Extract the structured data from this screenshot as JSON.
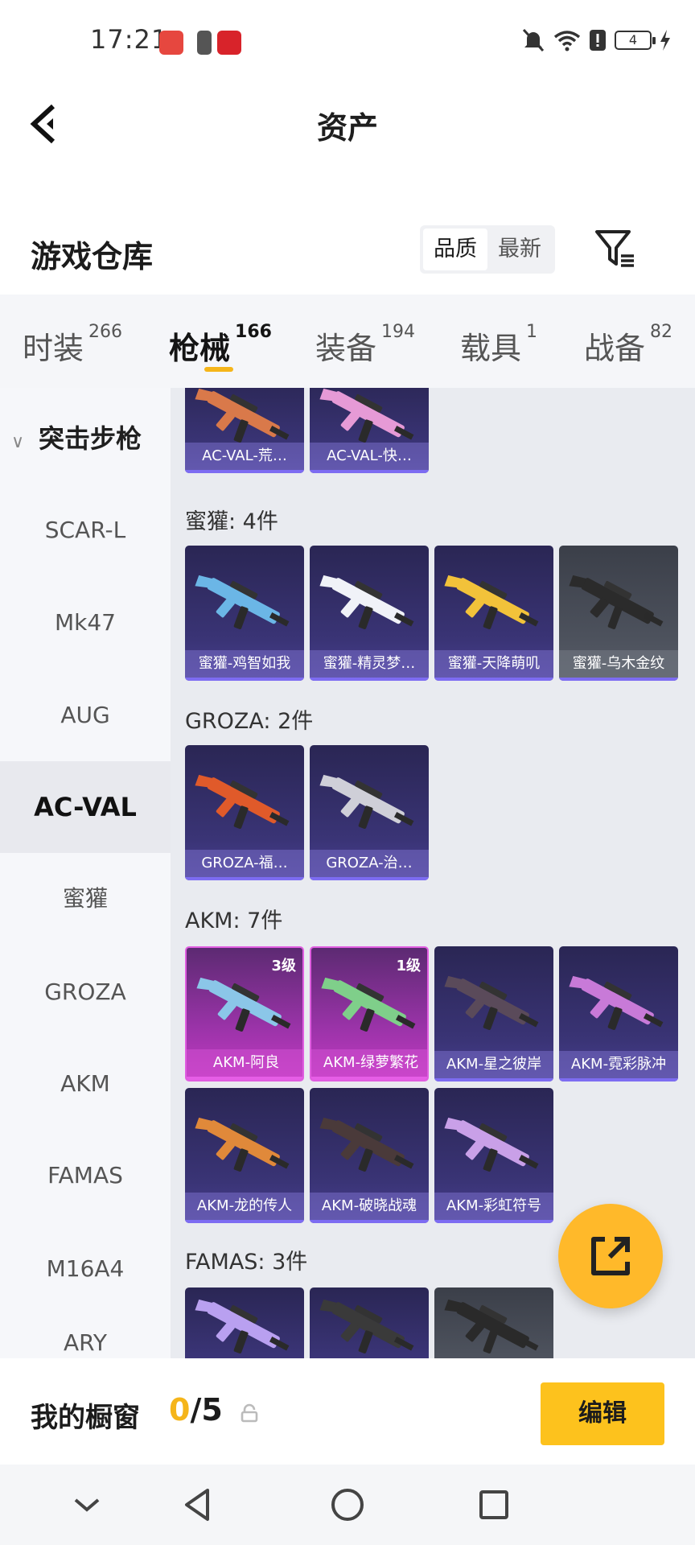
{
  "status_bar": {
    "time": "17:21",
    "battery": "4",
    "icons": [
      "huawei-app-icon",
      "battery-app-icon",
      "heart-app-icon",
      "mute-bell-icon",
      "wifi-icon",
      "alert-icon",
      "battery-icon",
      "charging-icon"
    ]
  },
  "header": {
    "back_icon": "back-chevron-icon",
    "title": "资产"
  },
  "warehouse": {
    "title": "游戏仓库",
    "sort_options": [
      "品质",
      "最新"
    ],
    "sort_selected": "品质",
    "filter_icon": "filter-icon"
  },
  "tabs": [
    {
      "label": "时装",
      "count": "266"
    },
    {
      "label": "枪械",
      "count": "166",
      "active": true
    },
    {
      "label": "装备",
      "count": "194"
    },
    {
      "label": "载具",
      "count": "1"
    },
    {
      "label": "战备",
      "count": "82"
    }
  ],
  "sidebar": {
    "category": "突击步枪",
    "items": [
      "SCAR-L",
      "Mk47",
      "AUG",
      "AC-VAL",
      "蜜獾",
      "GROZA",
      "AKM",
      "FAMAS",
      "M16A4",
      "ARY"
    ],
    "active": "AC-VAL"
  },
  "groups": [
    {
      "label": "",
      "items": [
        {
          "name": "AC-VAL-荒…",
          "style": "purple"
        },
        {
          "name": "AC-VAL-快…",
          "style": "purple"
        }
      ]
    },
    {
      "label": "蜜獾: 4件",
      "items": [
        {
          "name": "蜜獾-鸡智如我",
          "style": "purple"
        },
        {
          "name": "蜜獾-精灵梦…",
          "style": "purple"
        },
        {
          "name": "蜜獾-天降萌叽",
          "style": "purple"
        },
        {
          "name": "蜜獾-乌木金纹",
          "style": "gray"
        }
      ]
    },
    {
      "label": "GROZA: 2件",
      "items": [
        {
          "name": "GROZA-福…",
          "style": "purple"
        },
        {
          "name": "GROZA-治…",
          "style": "purple"
        }
      ]
    },
    {
      "label": "AKM: 7件",
      "items": [
        {
          "name": "AKM-阿良",
          "style": "pink",
          "level": "3级"
        },
        {
          "name": "AKM-绿萝繁花",
          "style": "pink",
          "level": "1级"
        },
        {
          "name": "AKM-星之彼岸",
          "style": "purple"
        },
        {
          "name": "AKM-霓彩脉冲",
          "style": "purple"
        },
        {
          "name": "AKM-龙的传人",
          "style": "purple"
        },
        {
          "name": "AKM-破晓战魂",
          "style": "purple"
        },
        {
          "name": "AKM-彩虹符号",
          "style": "purple"
        }
      ]
    },
    {
      "label": "FAMAS: 3件",
      "items": [
        {
          "name": "",
          "style": "purple"
        },
        {
          "name": "",
          "style": "purple"
        },
        {
          "name": "",
          "style": "gray"
        }
      ]
    }
  ],
  "fab": {
    "icon": "share-external-icon"
  },
  "showcase": {
    "title": "我的橱窗",
    "count_current": "0",
    "count_sep_total": "/5",
    "lock_icon": "lock-icon",
    "edit_label": "编辑"
  },
  "navbar": {
    "icons": [
      "collapse-chevron-icon",
      "back-triangle-icon",
      "home-circle-icon",
      "recents-square-icon"
    ]
  },
  "colors": {
    "accent": "#f5b51a",
    "edit_button": "#fdc21d",
    "fab": "#ffb92a",
    "card_purple": "#3a3476",
    "card_pink": "#9a33a8",
    "card_gray": "#4d525d"
  }
}
